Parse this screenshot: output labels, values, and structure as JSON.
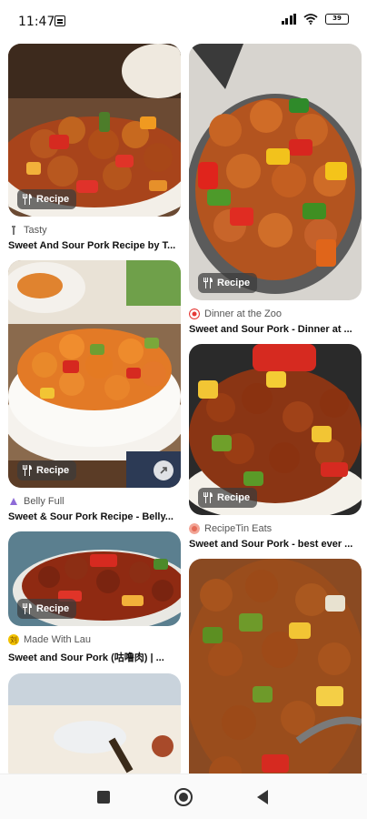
{
  "status_bar": {
    "time": "11:47",
    "battery": "39"
  },
  "pins": [
    {
      "id": "p1",
      "badge": "Recipe",
      "source": "Tasty",
      "source_color": "#9aa0a6",
      "title": "Sweet And Sour Pork Recipe by T..."
    },
    {
      "id": "p2",
      "badge": "Recipe",
      "source": "Dinner at the Zoo",
      "source_color": "#e53935",
      "title": "Sweet and Sour Pork - Dinner at ..."
    },
    {
      "id": "p3",
      "badge": "Recipe",
      "source": "Belly Full",
      "source_color": "#8e6bd8",
      "title": "Sweet & Sour Pork Recipe - Belly..."
    },
    {
      "id": "p4",
      "badge": "Recipe",
      "source": "RecipeTin Eats",
      "source_color": "#ef8a7a",
      "title": "Sweet and Sour Pork - best ever ..."
    },
    {
      "id": "p5",
      "badge": "Recipe",
      "source": "Made With Lau",
      "source_color": "#f2c200",
      "title": "Sweet and Sour Pork (咕噜肉) | ..."
    }
  ]
}
